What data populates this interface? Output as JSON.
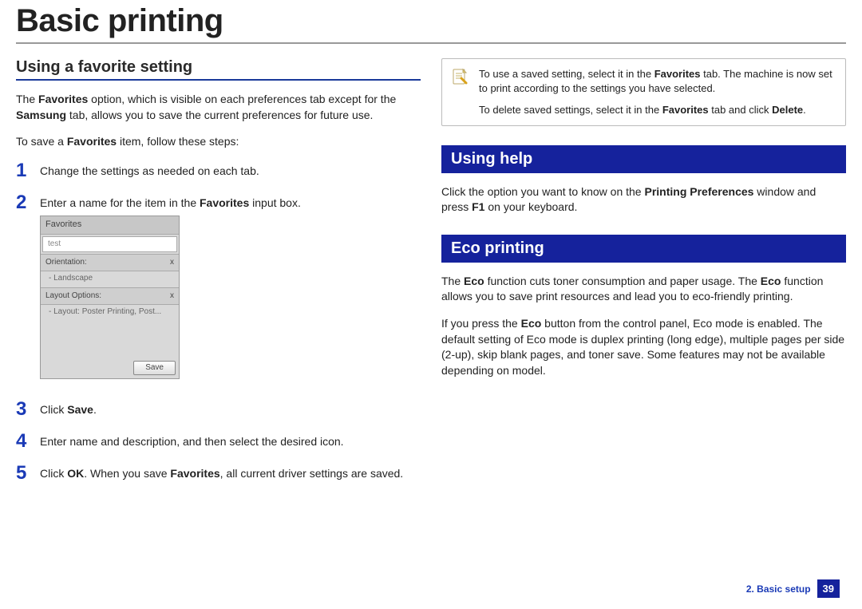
{
  "pageTitle": "Basic printing",
  "left": {
    "heading": "Using a favorite setting",
    "intro_parts": [
      "The ",
      "Favorites",
      " option, which is visible on each preferences tab except for the ",
      "Samsung",
      " tab, allows you to save the current preferences for future use."
    ],
    "save_intro_parts": [
      "To save a ",
      "Favorites",
      " item, follow these steps:"
    ],
    "steps": {
      "s1": "Change the settings as needed on each tab.",
      "s2_parts": [
        "Enter a name for the item in the ",
        "Favorites",
        " input box."
      ],
      "s3_parts": [
        "Click ",
        "Save",
        "."
      ],
      "s4": "Enter name and description, and then select the desired icon.",
      "s5_parts": [
        "Click ",
        "OK",
        ". When you save ",
        "Favorites",
        ", all current driver settings are saved."
      ]
    },
    "favui": {
      "title": "Favorites",
      "input": "test",
      "orientation_label": "Orientation:",
      "orientation_value": "- Landscape",
      "layout_label": "Layout Options:",
      "layout_value": "- Layout: Poster Printing, Post...",
      "save_btn": "Save",
      "x": "x"
    }
  },
  "right": {
    "note": {
      "p1_parts": [
        "To use a saved setting, select it in the ",
        "Favorites",
        " tab. The machine is now set to print according to the settings you have selected."
      ],
      "p2_parts": [
        "To delete saved settings, select it in the ",
        "Favorites",
        " tab and click ",
        "Delete",
        "."
      ]
    },
    "help_heading": "Using help",
    "help_body_parts": [
      "Click the option you want to know on the ",
      "Printing Preferences",
      " window and press ",
      "F1",
      " on your keyboard."
    ],
    "eco_heading": "Eco printing",
    "eco_p1_parts": [
      "The ",
      "Eco",
      " function cuts toner consumption and paper usage. The ",
      "Eco",
      " function allows you to save print resources and lead you to eco-friendly printing."
    ],
    "eco_p2_parts": [
      "If you press the ",
      "Eco",
      " button from the control panel, Eco mode is enabled. The default setting of Eco mode is duplex printing (long edge), multiple pages per side (2-up), skip blank pages, and toner save. Some features may not be available depending on model."
    ]
  },
  "footer": {
    "chapter": "2. Basic setup",
    "page": "39"
  }
}
